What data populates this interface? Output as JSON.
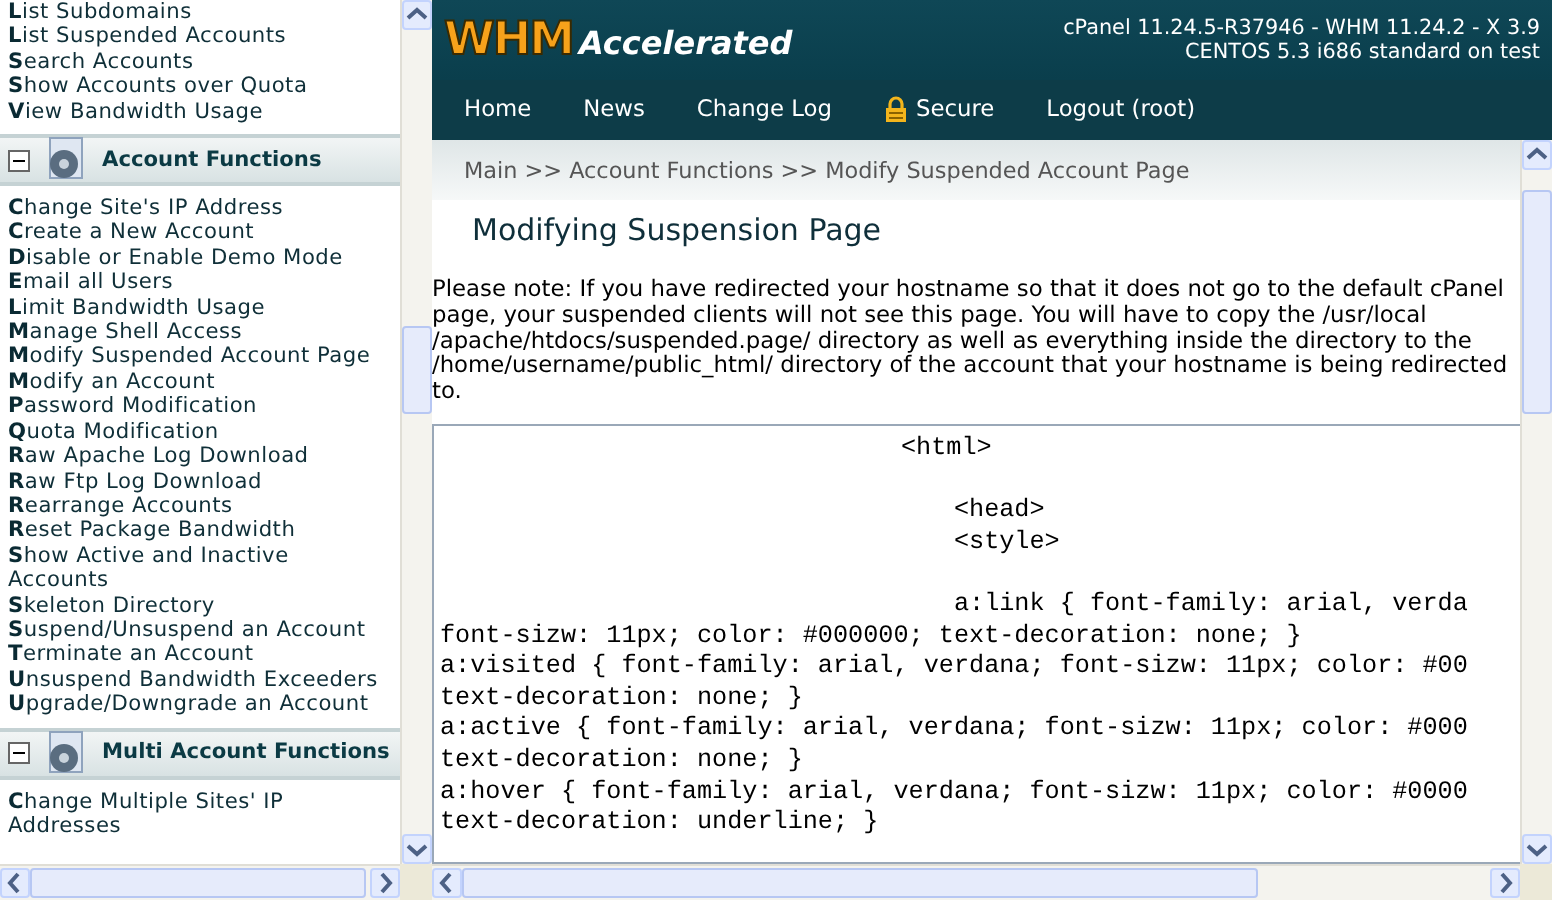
{
  "sidebar": {
    "groups": [
      {
        "items": [
          "**L**ist Subdomains",
          "**L**ist Suspended Accounts",
          "**S**earch Accounts",
          "**S**how Accounts over Quota",
          "**V**iew Bandwidth Usage"
        ]
      },
      {
        "title": "Account Functions",
        "expanded": true,
        "items": [
          "**C**hange Site's IP Address",
          "**C**reate a New Account",
          "**D**isable or Enable Demo Mode",
          "**E**mail all Users",
          "**L**imit Bandwidth Usage",
          "**M**anage Shell Access",
          "**M**odify Suspended Account Page",
          "**M**odify an Account",
          "**P**assword Modification",
          "**Q**uota Modification",
          "**R**aw Apache Log Download",
          "**R**aw Ftp Log Download",
          "**R**earrange Accounts",
          "**R**eset Package Bandwidth",
          "**S**how Active and Inactive Accounts",
          "**S**keleton Directory",
          "**S**uspend/Unsuspend an Account",
          "**T**erminate an Account",
          "**U**nsuspend Bandwidth Exceeders",
          "**U**pgrade/Downgrade an Account"
        ]
      },
      {
        "title": "Multi Account Functions",
        "expanded": true,
        "items": [
          "**C**hange Multiple Sites' IP Addresses"
        ]
      }
    ]
  },
  "header": {
    "logo": {
      "mark": "WHM",
      "word": "Accelerated"
    },
    "version_lines": [
      "cPanel 11.24.5-R37946 - WHM 11.24.2 - X 3.9",
      "CENTOS 5.3 i686 standard on test"
    ]
  },
  "nav": [
    {
      "label": "Home",
      "kind": "link"
    },
    {
      "label": "News",
      "kind": "link"
    },
    {
      "label": "Change Log",
      "kind": "link"
    },
    {
      "label": "Secure",
      "kind": "secure"
    },
    {
      "label": "Logout (root)",
      "kind": "link"
    }
  ],
  "breadcrumb": "Main >> Account Functions >> Modify Suspended Account Page",
  "title": "Modifying Suspension Page",
  "note": "Please note: If you have redirected your hostname so that it does not go to the default cPanel page, your suspended clients will not see this page. You will have to copy the /usr/local /apache/htdocs/suspended.page/ directory as well as everything inside the directory to the /home/username/public_html/ directory of the account that your hostname is being redirected to.",
  "editor": {
    "lines": [
      {
        "kind": "outer",
        "text": "<html>"
      },
      {
        "kind": "blank"
      },
      {
        "kind": "inner",
        "text": "<head>"
      },
      {
        "kind": "inner",
        "text": "<style>"
      },
      {
        "kind": "blank"
      },
      {
        "kind": "inner",
        "text": "a:link { font-family: arial, verda"
      },
      {
        "kind": "plain",
        "text": "font-sizw: 11px; color: #000000; text-decoration: none; }"
      },
      {
        "kind": "plain",
        "text": "a:visited { font-family: arial, verdana; font-sizw: 11px; color: #00"
      },
      {
        "kind": "plain",
        "text": "text-decoration: none; }"
      },
      {
        "kind": "plain",
        "text": "a:active { font-family: arial, verdana; font-sizw: 11px; color: #000"
      },
      {
        "kind": "plain",
        "text": "text-decoration: none; }"
      },
      {
        "kind": "plain",
        "text": "a:hover { font-family: arial, verdana; font-sizw: 11px; color: #0000"
      },
      {
        "kind": "plain",
        "text": "text-decoration: underline; }"
      }
    ]
  }
}
